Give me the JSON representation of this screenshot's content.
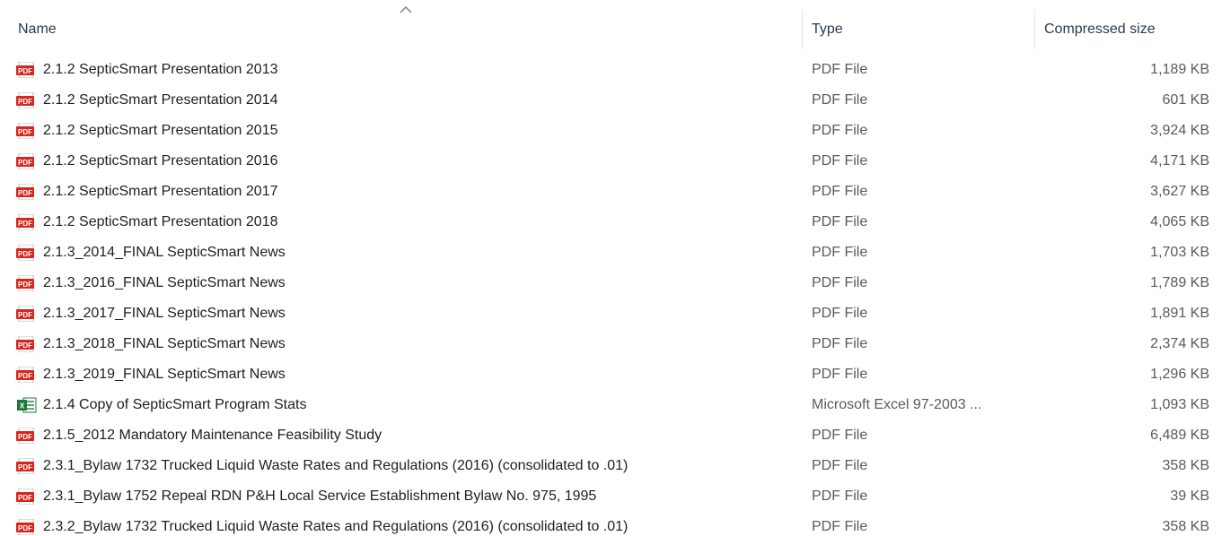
{
  "columns": {
    "name": "Name",
    "type": "Type",
    "compressed_size": "Compressed size"
  },
  "icons": {
    "pdf": "pdf-file-icon",
    "excel": "excel-file-icon"
  },
  "colors": {
    "pdf_red": "#d7261e",
    "excel_green": "#1d7a3a"
  },
  "files": [
    {
      "name": "2.1.2 SepticSmart Presentation 2013",
      "type": "PDF File",
      "size": "1,189 KB",
      "icon": "pdf"
    },
    {
      "name": "2.1.2 SepticSmart Presentation 2014",
      "type": "PDF File",
      "size": "601 KB",
      "icon": "pdf"
    },
    {
      "name": "2.1.2 SepticSmart Presentation 2015",
      "type": "PDF File",
      "size": "3,924 KB",
      "icon": "pdf"
    },
    {
      "name": "2.1.2 SepticSmart Presentation 2016",
      "type": "PDF File",
      "size": "4,171 KB",
      "icon": "pdf"
    },
    {
      "name": "2.1.2 SepticSmart Presentation 2017",
      "type": "PDF File",
      "size": "3,627 KB",
      "icon": "pdf"
    },
    {
      "name": "2.1.2 SepticSmart Presentation 2018",
      "type": "PDF File",
      "size": "4,065 KB",
      "icon": "pdf"
    },
    {
      "name": "2.1.3_2014_FINAL SepticSmart News",
      "type": "PDF File",
      "size": "1,703 KB",
      "icon": "pdf"
    },
    {
      "name": "2.1.3_2016_FINAL SepticSmart News",
      "type": "PDF File",
      "size": "1,789 KB",
      "icon": "pdf"
    },
    {
      "name": "2.1.3_2017_FINAL SepticSmart News",
      "type": "PDF File",
      "size": "1,891 KB",
      "icon": "pdf"
    },
    {
      "name": "2.1.3_2018_FINAL SepticSmart News",
      "type": "PDF File",
      "size": "2,374 KB",
      "icon": "pdf"
    },
    {
      "name": "2.1.3_2019_FINAL SepticSmart News",
      "type": "PDF File",
      "size": "1,296 KB",
      "icon": "pdf"
    },
    {
      "name": "2.1.4 Copy of SepticSmart Program Stats",
      "type": "Microsoft Excel 97-2003 ...",
      "size": "1,093 KB",
      "icon": "excel"
    },
    {
      "name": "2.1.5_2012 Mandatory Maintenance Feasibility Study",
      "type": "PDF File",
      "size": "6,489 KB",
      "icon": "pdf"
    },
    {
      "name": "2.3.1_Bylaw 1732 Trucked Liquid Waste Rates and Regulations (2016) (consolidated to .01)",
      "type": "PDF File",
      "size": "358 KB",
      "icon": "pdf"
    },
    {
      "name": "2.3.1_Bylaw 1752 Repeal RDN P&H Local Service Establishment Bylaw No. 975, 1995",
      "type": "PDF File",
      "size": "39 KB",
      "icon": "pdf"
    },
    {
      "name": "2.3.2_Bylaw 1732 Trucked Liquid Waste Rates and Regulations (2016) (consolidated to .01)",
      "type": "PDF File",
      "size": "358 KB",
      "icon": "pdf"
    }
  ]
}
